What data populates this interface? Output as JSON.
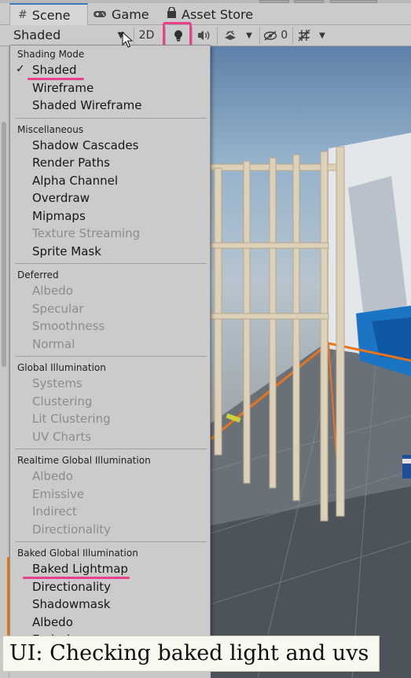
{
  "tabs": [
    {
      "label": "Scene",
      "icon": "hash-icon",
      "active": true
    },
    {
      "label": "Game",
      "icon": "gamepad-icon",
      "active": false
    },
    {
      "label": "Asset Store",
      "icon": "shopping-bag-icon",
      "active": false
    }
  ],
  "toolbar": {
    "shading_mode": "Shaded",
    "mode_2d": "2D",
    "gizmo_count": "0",
    "icons": [
      "lightbulb-icon",
      "speaker-icon",
      "effects-icon",
      "eye-slash-icon",
      "grid-icon"
    ]
  },
  "menu": {
    "sections": [
      {
        "header": "Shading Mode",
        "items": [
          {
            "label": "Shaded",
            "checked": true,
            "enabled": true
          },
          {
            "label": "Wireframe",
            "enabled": true
          },
          {
            "label": "Shaded Wireframe",
            "enabled": true
          }
        ]
      },
      {
        "header": "Miscellaneous",
        "items": [
          {
            "label": "Shadow Cascades",
            "enabled": true
          },
          {
            "label": "Render Paths",
            "enabled": true
          },
          {
            "label": "Alpha Channel",
            "enabled": true
          },
          {
            "label": "Overdraw",
            "enabled": true
          },
          {
            "label": "Mipmaps",
            "enabled": true
          },
          {
            "label": "Texture Streaming",
            "enabled": false
          },
          {
            "label": "Sprite Mask",
            "enabled": true
          }
        ]
      },
      {
        "header": "Deferred",
        "items": [
          {
            "label": "Albedo",
            "enabled": false
          },
          {
            "label": "Specular",
            "enabled": false
          },
          {
            "label": "Smoothness",
            "enabled": false
          },
          {
            "label": "Normal",
            "enabled": false
          }
        ]
      },
      {
        "header": "Global Illumination",
        "items": [
          {
            "label": "Systems",
            "enabled": false
          },
          {
            "label": "Clustering",
            "enabled": false
          },
          {
            "label": "Lit Clustering",
            "enabled": false
          },
          {
            "label": "UV Charts",
            "enabled": false
          }
        ]
      },
      {
        "header": "Realtime Global Illumination",
        "items": [
          {
            "label": "Albedo",
            "enabled": false
          },
          {
            "label": "Emissive",
            "enabled": false
          },
          {
            "label": "Indirect",
            "enabled": false
          },
          {
            "label": "Directionality",
            "enabled": false
          }
        ]
      },
      {
        "header": "Baked Global Illumination",
        "items": [
          {
            "label": "Baked Lightmap",
            "enabled": true
          },
          {
            "label": "Directionality",
            "enabled": true
          },
          {
            "label": "Shadowmask",
            "enabled": true
          },
          {
            "label": "Albedo",
            "enabled": true
          },
          {
            "label": "Emissive",
            "enabled": true
          }
        ]
      }
    ]
  },
  "caption": "UI: Checking baked light and uvs",
  "colors": {
    "highlight": "#ea3f8c",
    "selection_orange": "#e3791f",
    "tab_accent": "#3a79bd"
  }
}
